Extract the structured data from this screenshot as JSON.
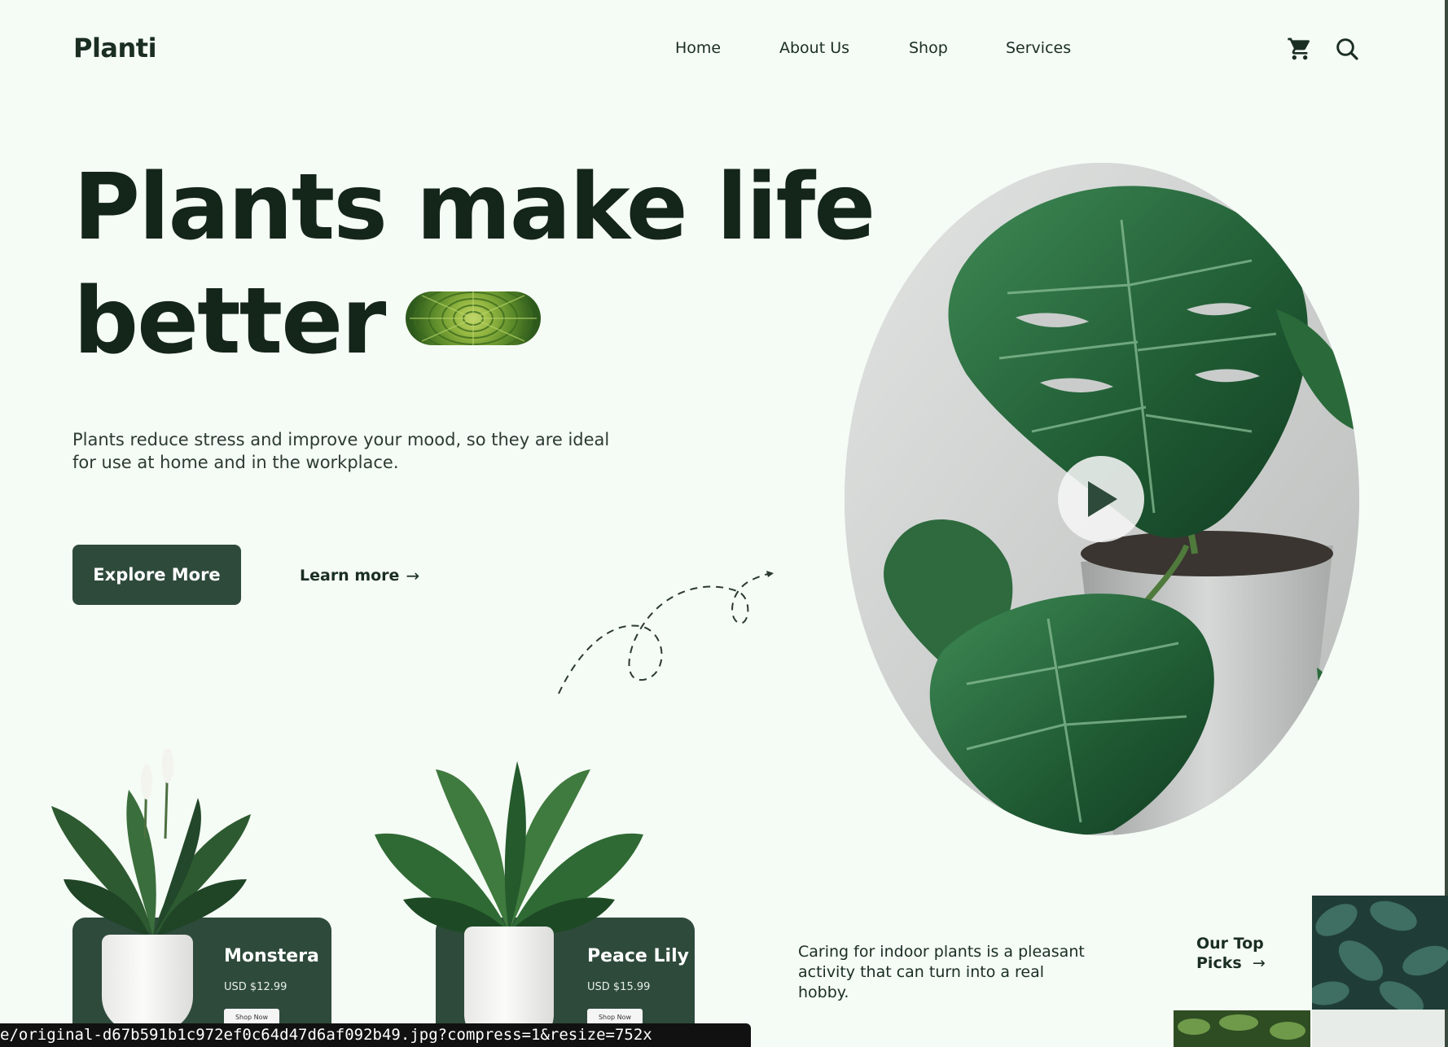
{
  "brand": {
    "logo": "Planti"
  },
  "nav": {
    "items": [
      {
        "label": "Home"
      },
      {
        "label": "About Us"
      },
      {
        "label": "Shop"
      },
      {
        "label": "Services"
      }
    ],
    "icons": [
      "cart-icon",
      "search-icon"
    ]
  },
  "hero": {
    "headline_line1": "Plants make life",
    "headline_line2": "better",
    "subtitle": "Plants reduce stress and improve your mood, so they are ideal for use at home and in the workplace.",
    "primary_button": "Explore More",
    "secondary_link": "Learn more",
    "secondary_link_arrow": "→"
  },
  "products": [
    {
      "name": "Monstera",
      "price": "USD $12.99",
      "cta": "Shop Now"
    },
    {
      "name": "Peace Lily",
      "price": "USD $15.99",
      "cta": "Shop Now"
    }
  ],
  "info": {
    "caring_text": "Caring for indoor plants is a pleasant activity that can turn into a real hobby.",
    "top_picks_line1": "Our Top",
    "top_picks_line2": "Picks",
    "top_picks_arrow": "→"
  },
  "status_url": "e/original-d67b591b1c972ef0c64d47d6af092b49.jpg?compress=1&resize=752x",
  "colors": {
    "background": "#f5fbf5",
    "primary_dark_green": "#2e4a3b",
    "text_dark": "#142519"
  }
}
